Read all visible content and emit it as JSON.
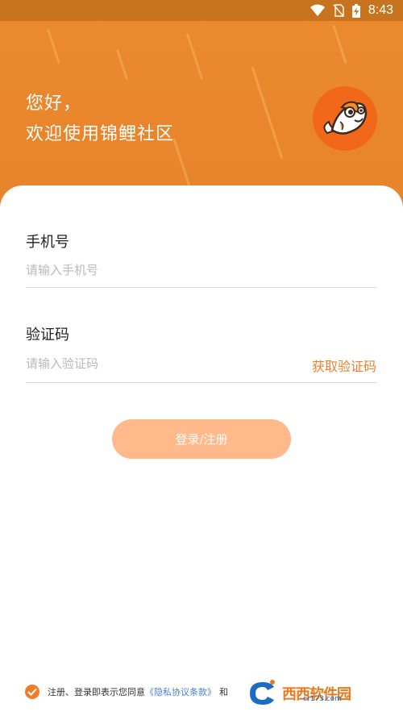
{
  "status_bar": {
    "time": "8:43",
    "icons": [
      "wifi-icon",
      "no-sim-icon",
      "battery-charging-icon"
    ]
  },
  "header": {
    "greeting_line1": "您好，",
    "greeting_line2": "欢迎使用锦鲤社区",
    "logo_icon": "koi-fish-icon",
    "colors": {
      "header_bg": "#e8842b",
      "logo_bg": "#f2681b"
    }
  },
  "form": {
    "phone": {
      "label": "手机号",
      "placeholder": "请输入手机号",
      "value": ""
    },
    "code": {
      "label": "验证码",
      "placeholder": "请输入验证码",
      "value": "",
      "get_code_label": "获取验证码"
    },
    "submit_label": "登录/注册",
    "colors": {
      "accent": "#ef7f2b",
      "button_bg": "#ffb98a"
    }
  },
  "agreement": {
    "checked": true,
    "text": "注册、登录即表示您同意",
    "privacy_link": "《隐私协议条款》",
    "and_text": "和"
  },
  "watermark": {
    "brand": "西西软件园",
    "url": "cr173.com"
  }
}
